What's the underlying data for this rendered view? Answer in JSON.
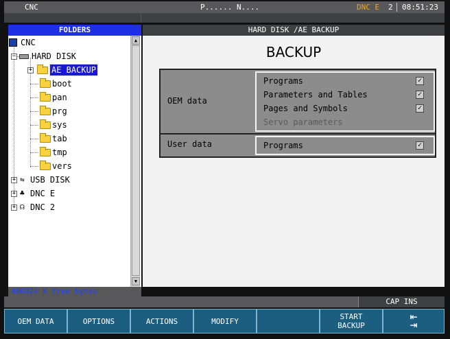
{
  "topbar": {
    "app": "CNC",
    "program": "P...... N....",
    "mode": "DNC E",
    "channel": "2",
    "clock": "08:51:23"
  },
  "folders": {
    "title": "FOLDERS",
    "items": [
      {
        "label": "CNC",
        "icon": "cnc-icon"
      },
      {
        "label": "HARD DISK",
        "icon": "hard-disk-icon"
      },
      {
        "label": "AE BACKUP",
        "icon": "folder-open-icon",
        "selected": true
      },
      {
        "label": "boot",
        "icon": "folder-icon"
      },
      {
        "label": "pan",
        "icon": "folder-icon"
      },
      {
        "label": "prg",
        "icon": "folder-icon"
      },
      {
        "label": "sys",
        "icon": "folder-icon"
      },
      {
        "label": "tab",
        "icon": "folder-icon"
      },
      {
        "label": "tmp",
        "icon": "folder-icon"
      },
      {
        "label": "vers",
        "icon": "folder-icon"
      },
      {
        "label": "USB DISK",
        "icon": "usb-icon"
      },
      {
        "label": "DNC E",
        "icon": "network-icon"
      },
      {
        "label": "DNC 2",
        "icon": "serial-icon"
      }
    ],
    "free_space": "486924 K free bytes"
  },
  "panel": {
    "path": "HARD DISK /AE BACKUP",
    "title": "BACKUP",
    "oem_label": "OEM data",
    "oem_options": [
      {
        "label": "Programs",
        "checked": true,
        "enabled": true
      },
      {
        "label": "Parameters and Tables",
        "checked": true,
        "enabled": true
      },
      {
        "label": "Pages and Symbols",
        "checked": true,
        "enabled": true
      },
      {
        "label": "Servo parameters",
        "checked": false,
        "enabled": false
      }
    ],
    "user_label": "User data",
    "user_options": [
      {
        "label": "Programs",
        "checked": true,
        "enabled": true
      }
    ]
  },
  "status": {
    "cap_ins": "CAP INS"
  },
  "softkeys": {
    "oem_data": "OEM DATA",
    "options": "OPTIONS",
    "actions": "ACTIONS",
    "modify": "MODIFY",
    "empty": "",
    "start_backup_1": "START",
    "start_backup_2": "BACKUP",
    "switch": "⇤ ⇥"
  },
  "colors": {
    "accent_blue": "#1e30e6",
    "softkey_bg": "#1c5e80",
    "mode_orange": "#f2a31a",
    "free_text_blue": "#1e40ff"
  }
}
